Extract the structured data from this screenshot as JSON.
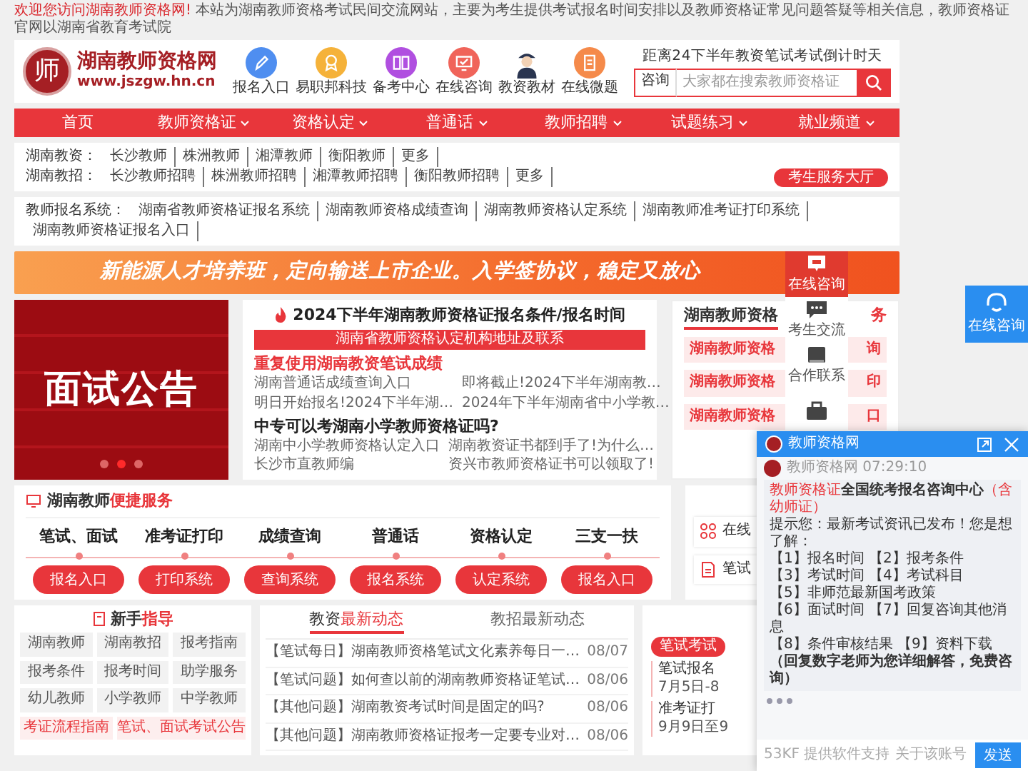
{
  "notice": {
    "lead": "欢迎您访问湖南教师资格网!",
    "text": "本站为湖南教师资格考试民间交流网站，主要为考生提供考试报名时间安排以及教师资格证常见问题答疑等相关信息，教师资格证官网以湖南省教育考试院"
  },
  "header": {
    "logo_char": "师",
    "site_name": "湖南教师资格网",
    "site_url": "www.jszgw.hn.cn",
    "shortcuts": [
      {
        "label": "报名入口",
        "kind": "pencil",
        "color": "#4f8ef0"
      },
      {
        "label": "易职邦科技",
        "kind": "medal",
        "color": "#f5b23a"
      },
      {
        "label": "备考中心",
        "kind": "book",
        "color": "#b04fe0"
      },
      {
        "label": "在线咨询",
        "kind": "monitor",
        "color": "#f0645a"
      },
      {
        "label": "教资教材",
        "kind": "figure",
        "color": "#2a3550"
      },
      {
        "label": "在线微题",
        "kind": "note",
        "color": "#f58a4a"
      }
    ],
    "countdown": "距离24下半年教资笔试考试倒计时天",
    "search": {
      "label": "咨询",
      "placeholder": "大家都在搜索教师资格证"
    }
  },
  "nav": [
    {
      "label": "首页",
      "dropdown": false
    },
    {
      "label": "教师资格证",
      "dropdown": true
    },
    {
      "label": "资格认定",
      "dropdown": true
    },
    {
      "label": "普通话",
      "dropdown": true
    },
    {
      "label": "教师招聘",
      "dropdown": true
    },
    {
      "label": "试题练习",
      "dropdown": true
    },
    {
      "label": "就业频道",
      "dropdown": true
    }
  ],
  "city_links": [
    {
      "label": "湖南教资：",
      "links": [
        "长沙教师",
        "株洲教师",
        "湘潭教师",
        "衡阳教师",
        "更多"
      ]
    },
    {
      "label": "湖南教招：",
      "links": [
        "长沙教师招聘",
        "株洲教师招聘",
        "湘潭教师招聘",
        "衡阳教师招聘",
        "更多"
      ]
    }
  ],
  "service_hall_button": "考生服务大厅",
  "systems": {
    "label": "教师报名系统：",
    "links": [
      "湖南省教师资格证报名系统",
      "湖南教师资格成绩查询",
      "湖南教师资格认定系统",
      "湖南教师准考证打印系统",
      "湖南教师资格证报名入口"
    ]
  },
  "banner": "新能源人才培养班，定向输送上市企业。入学签协议，稳定又放心",
  "slide": {
    "title": "面试公告",
    "dots": [
      {
        "selected": false
      },
      {
        "selected": true
      },
      {
        "selected": false
      }
    ]
  },
  "headlines": {
    "top": "2024下半年湖南教师资格证报名条件/报名时间",
    "bar": "湖南省教师资格认定机构地址及联系",
    "groups": [
      {
        "title": "重复使用湖南教资笔试成绩",
        "accent": true,
        "links": [
          "湖南普通话成绩查询入口",
          "即将截止!2024下半年湖南教…",
          "明日开始报名!2024下半年湖…",
          "2024年下半年湖南省中小学教…"
        ]
      },
      {
        "title": "中专可以考湖南小学教师资格证吗?",
        "accent": false,
        "links": [
          "湖南中小学教师资格认定入口",
          "湖南教资证书都到手了!为什么…",
          "长沙市直教师编",
          "资兴市教师资格证书可以领取了!"
        ]
      }
    ]
  },
  "service_panel": {
    "title_left": "湖南教师资格",
    "title_right": "务",
    "buttons": [
      {
        "left": "湖南教师资格",
        "right": "询"
      },
      {
        "left": "湖南教师资格",
        "right": "印"
      },
      {
        "left": "湖南教师资格",
        "right": "口"
      }
    ]
  },
  "float_sidebar": [
    {
      "label": "在线咨询",
      "kind": "chat",
      "selected": true
    },
    {
      "label": "考生交流",
      "kind": "message",
      "selected": false
    },
    {
      "label": "合作联系",
      "kind": "card",
      "selected": false
    },
    {
      "kind": "briefcase",
      "selected": false
    }
  ],
  "float_button": {
    "label": "在线咨询"
  },
  "quick_service": {
    "lead": "湖南教师",
    "accent": "便捷服务",
    "steps": [
      {
        "title": "笔试、面试",
        "button": "报名入口"
      },
      {
        "title": "准考证打印",
        "button": "打印系统"
      },
      {
        "title": "成绩查询",
        "button": "查询系统"
      },
      {
        "title": "普通话",
        "button": "报名系统"
      },
      {
        "title": "资格认定",
        "button": "认定系统"
      },
      {
        "title": "三支一扶",
        "button": "报名入口"
      }
    ]
  },
  "side_links": [
    {
      "text": "在线",
      "kind": "apps"
    },
    {
      "text": "笔试",
      "kind": "doc"
    }
  ],
  "guide": {
    "lead": "新手",
    "accent": "指导",
    "items": [
      "湖南教师",
      "湖南教招",
      "报考指南",
      "报考条件",
      "报考时间",
      "助学服务",
      "幼儿教师",
      "小学教师",
      "中学教师"
    ],
    "featured": [
      "考证流程指南",
      "笔试、面试考试公告"
    ]
  },
  "news": {
    "tabs": [
      {
        "lead": "教资",
        "accent": "最新动态",
        "selected": true
      },
      {
        "lead": "教招",
        "accent": "最新动态",
        "selected": false
      }
    ],
    "items": [
      {
        "title": "【笔试每日】湖南教师资格笔试文化素养每日一…",
        "date": "08/07"
      },
      {
        "title": "【笔试问题】如何查以前的湖南教师资格证笔试…",
        "date": "08/06"
      },
      {
        "title": "【其他问题】湖南教资考试时间是固定的吗?",
        "date": "08/06"
      },
      {
        "title": "【其他问题】湖南教师资格证报考一定要专业对…",
        "date": "08/06"
      }
    ]
  },
  "schedule": {
    "tag": "笔试考试",
    "items": [
      {
        "title": "笔试报名",
        "date": "7月5日-8"
      },
      {
        "title": "准考证打",
        "date": "9月9日至9"
      }
    ]
  },
  "chat": {
    "title": "教师资格网",
    "sender": "教师资格网 07:29:10",
    "heading": [
      {
        "text": "教师资格证",
        "kind": "brand"
      },
      {
        "text": "全国统考报名咨询中心",
        "kind": "strong"
      },
      {
        "text": "（含幼师证）",
        "kind": "brand"
      }
    ],
    "tip": "提示您：最新考试资讯已发布！您是想了解：",
    "options": [
      "【1】报名时间 【2】报考条件",
      "【3】考试时间 【4】考试科目",
      "【5】非师范最新国考政策",
      "【6】面试时间 【7】回复咨询其他消息",
      "【8】条件审核结果 【9】资料下载"
    ],
    "closing": "（回复数字老师为您详细解答，免费咨询）",
    "send": "发送",
    "footer_left": "53KF 提供软件支持",
    "footer_right": "关于该账号"
  }
}
